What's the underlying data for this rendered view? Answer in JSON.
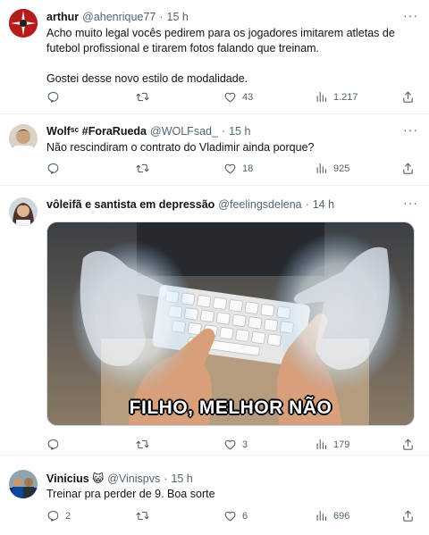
{
  "tweets": [
    {
      "name": "arthur",
      "handle": "@ahenrique77",
      "time": "15 h",
      "text": [
        "Acho muito legal vocês pedirem para os jogadores imitarem atletas de futebol profissional e tirarem fotos falando que treinam.",
        "Gostei desse novo estilo de modalidade."
      ],
      "stats": {
        "reply": "",
        "retweet": "",
        "like": "43",
        "views": "1.217"
      }
    },
    {
      "name": "Wolfˢᶜ #ForaRueda",
      "handle": "@WOLFsad_",
      "time": "15 h",
      "text": [
        "Não rescindiram o contrato do Vladimir ainda porque?"
      ],
      "stats": {
        "reply": "",
        "retweet": "",
        "like": "18",
        "views": "925"
      }
    },
    {
      "name": "vôleifã e santista em depressão",
      "handle": "@feelingsdelena",
      "time": "14 h",
      "text": [],
      "media_caption": "FILHO, MELHOR NÃO",
      "stats": {
        "reply": "",
        "retweet": "",
        "like": "3",
        "views": "179"
      }
    },
    {
      "name": "Vinicius 😺",
      "handle": "@Vinispvs",
      "time": "15 h",
      "text": [
        "Treinar pra perder de 9. Boa sorte"
      ],
      "stats": {
        "reply": "2",
        "retweet": "",
        "like": "6",
        "views": "696"
      }
    }
  ],
  "ui": {
    "more_icon": "···",
    "separator": "·"
  },
  "icons": {
    "reply": "reply-icon",
    "retweet": "retweet-icon",
    "like": "heart-icon",
    "views": "views-chart-icon",
    "share": "share-icon",
    "more": "more-icon"
  },
  "colors": {
    "text": "#0f1419",
    "secondary": "#536471",
    "border": "#eff3f4"
  }
}
